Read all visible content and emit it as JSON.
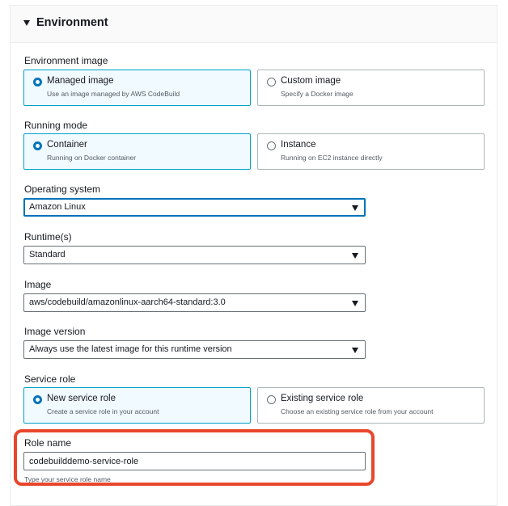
{
  "panel": {
    "title": "Environment"
  },
  "environment_image": {
    "label": "Environment image",
    "options": [
      {
        "title": "Managed image",
        "description": "Use an image managed by AWS CodeBuild",
        "selected": true
      },
      {
        "title": "Custom image",
        "description": "Specify a Docker image",
        "selected": false
      }
    ]
  },
  "running_mode": {
    "label": "Running mode",
    "options": [
      {
        "title": "Container",
        "description": "Running on Docker container",
        "selected": true
      },
      {
        "title": "Instance",
        "description": "Running on EC2 instance directly",
        "selected": false
      }
    ]
  },
  "operating_system": {
    "label": "Operating system",
    "value": "Amazon Linux"
  },
  "runtime": {
    "label": "Runtime(s)",
    "value": "Standard"
  },
  "image": {
    "label": "Image",
    "value": "aws/codebuild/amazonlinux-aarch64-standard:3.0"
  },
  "image_version": {
    "label": "Image version",
    "value": "Always use the latest image for this runtime version"
  },
  "service_role": {
    "label": "Service role",
    "options": [
      {
        "title": "New service role",
        "description": "Create a service role in your account",
        "selected": true
      },
      {
        "title": "Existing service role",
        "description": "Choose an existing service role from your account",
        "selected": false
      }
    ]
  },
  "role_name": {
    "label": "Role name",
    "value": "codebuilddemo-service-role",
    "hint": "Type your service role name"
  },
  "colors": {
    "accent": "#0073bb",
    "selected_border": "#00a1c9",
    "selected_bg": "#f1faff",
    "highlight": "#e8472d"
  },
  "icons": {
    "caret": "caret-down-icon",
    "dropdown": "chevron-down-icon"
  }
}
